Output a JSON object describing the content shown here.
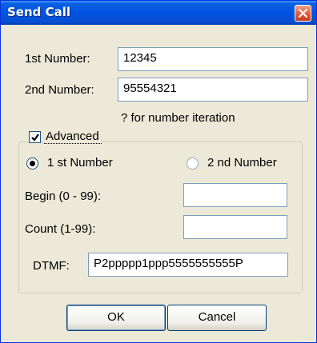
{
  "window": {
    "title": "Send Call"
  },
  "form": {
    "first_number_label": "1st Number:",
    "first_number_value": "12345",
    "second_number_label": "2nd Number:",
    "second_number_value": "95554321",
    "hint": "? for number iteration"
  },
  "advanced": {
    "label": "Advanced",
    "checked": true,
    "radio_first_label": "1 st Number",
    "radio_second_label": "2 nd Number",
    "selected": "1 st Number",
    "begin_label": "Begin (0 - 99):",
    "begin_value": "",
    "count_label": "Count (1-99):",
    "count_value": "",
    "dtmf_label": "DTMF:",
    "dtmf_value": "P2ppppp1ppp5555555555P"
  },
  "buttons": {
    "ok": "OK",
    "cancel": "Cancel"
  }
}
